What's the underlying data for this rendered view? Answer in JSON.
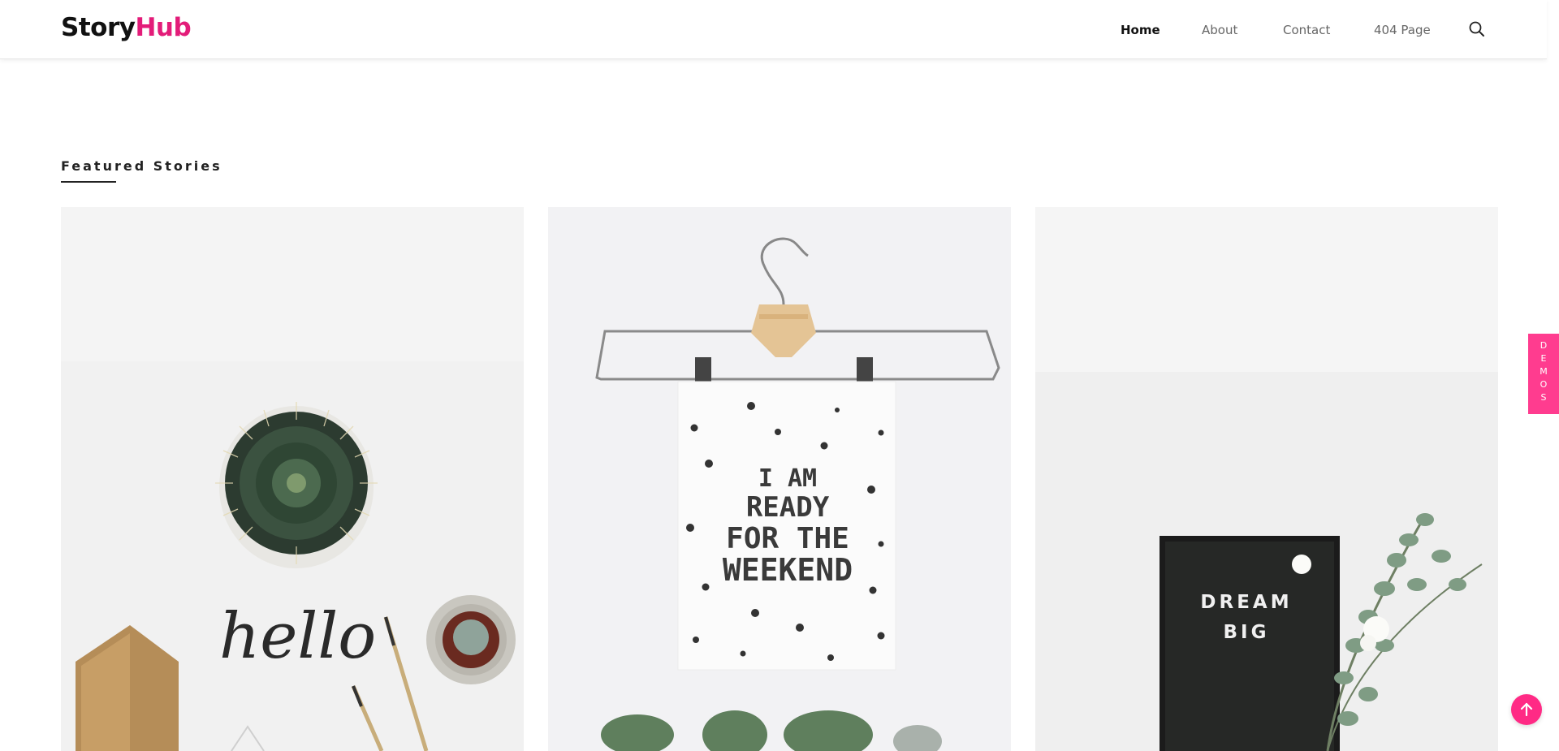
{
  "header": {
    "logo_part1": "Story",
    "logo_part2": "Hub",
    "nav": [
      {
        "label": "Home",
        "active": true
      },
      {
        "label": "About",
        "active": false
      },
      {
        "label": "Contact",
        "active": false
      },
      {
        "label": "404 Page",
        "active": false
      }
    ],
    "search_icon": "search-icon"
  },
  "main": {
    "section_title": "Featured Stories",
    "cards": [
      {
        "image": "cactus-hello-flatlay",
        "image_text": "hello"
      },
      {
        "image": "hanger-poster",
        "image_text": [
          "I AM",
          "READY",
          "FOR THE",
          "WEEKEND"
        ]
      },
      {
        "image": "letterboard-dream-big",
        "image_text": [
          "DREAM",
          "BIG"
        ]
      }
    ]
  },
  "side_tab": {
    "label": "DEMOS"
  },
  "back_to_top_icon": "arrow-up-icon",
  "colors": {
    "brand_pink": "#e31c79",
    "demos_pink": "#ff3c8f",
    "totop_pink": "#ff2a85"
  }
}
